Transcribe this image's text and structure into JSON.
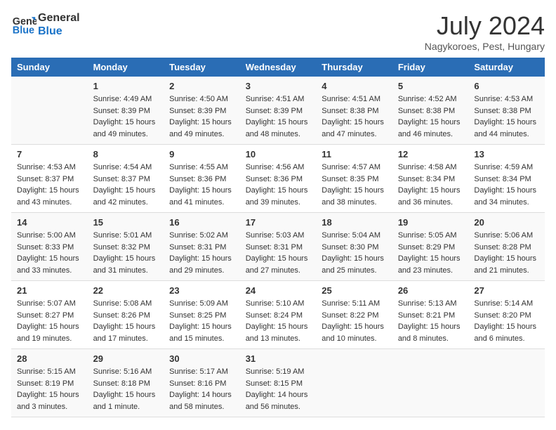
{
  "header": {
    "logo_line1": "General",
    "logo_line2": "Blue",
    "month_title": "July 2024",
    "location": "Nagykoroes, Pest, Hungary"
  },
  "columns": [
    "Sunday",
    "Monday",
    "Tuesday",
    "Wednesday",
    "Thursday",
    "Friday",
    "Saturday"
  ],
  "weeks": [
    [
      {
        "day": "",
        "info": ""
      },
      {
        "day": "1",
        "info": "Sunrise: 4:49 AM\nSunset: 8:39 PM\nDaylight: 15 hours\nand 49 minutes."
      },
      {
        "day": "2",
        "info": "Sunrise: 4:50 AM\nSunset: 8:39 PM\nDaylight: 15 hours\nand 49 minutes."
      },
      {
        "day": "3",
        "info": "Sunrise: 4:51 AM\nSunset: 8:39 PM\nDaylight: 15 hours\nand 48 minutes."
      },
      {
        "day": "4",
        "info": "Sunrise: 4:51 AM\nSunset: 8:38 PM\nDaylight: 15 hours\nand 47 minutes."
      },
      {
        "day": "5",
        "info": "Sunrise: 4:52 AM\nSunset: 8:38 PM\nDaylight: 15 hours\nand 46 minutes."
      },
      {
        "day": "6",
        "info": "Sunrise: 4:53 AM\nSunset: 8:38 PM\nDaylight: 15 hours\nand 44 minutes."
      }
    ],
    [
      {
        "day": "7",
        "info": "Sunrise: 4:53 AM\nSunset: 8:37 PM\nDaylight: 15 hours\nand 43 minutes."
      },
      {
        "day": "8",
        "info": "Sunrise: 4:54 AM\nSunset: 8:37 PM\nDaylight: 15 hours\nand 42 minutes."
      },
      {
        "day": "9",
        "info": "Sunrise: 4:55 AM\nSunset: 8:36 PM\nDaylight: 15 hours\nand 41 minutes."
      },
      {
        "day": "10",
        "info": "Sunrise: 4:56 AM\nSunset: 8:36 PM\nDaylight: 15 hours\nand 39 minutes."
      },
      {
        "day": "11",
        "info": "Sunrise: 4:57 AM\nSunset: 8:35 PM\nDaylight: 15 hours\nand 38 minutes."
      },
      {
        "day": "12",
        "info": "Sunrise: 4:58 AM\nSunset: 8:34 PM\nDaylight: 15 hours\nand 36 minutes."
      },
      {
        "day": "13",
        "info": "Sunrise: 4:59 AM\nSunset: 8:34 PM\nDaylight: 15 hours\nand 34 minutes."
      }
    ],
    [
      {
        "day": "14",
        "info": "Sunrise: 5:00 AM\nSunset: 8:33 PM\nDaylight: 15 hours\nand 33 minutes."
      },
      {
        "day": "15",
        "info": "Sunrise: 5:01 AM\nSunset: 8:32 PM\nDaylight: 15 hours\nand 31 minutes."
      },
      {
        "day": "16",
        "info": "Sunrise: 5:02 AM\nSunset: 8:31 PM\nDaylight: 15 hours\nand 29 minutes."
      },
      {
        "day": "17",
        "info": "Sunrise: 5:03 AM\nSunset: 8:31 PM\nDaylight: 15 hours\nand 27 minutes."
      },
      {
        "day": "18",
        "info": "Sunrise: 5:04 AM\nSunset: 8:30 PM\nDaylight: 15 hours\nand 25 minutes."
      },
      {
        "day": "19",
        "info": "Sunrise: 5:05 AM\nSunset: 8:29 PM\nDaylight: 15 hours\nand 23 minutes."
      },
      {
        "day": "20",
        "info": "Sunrise: 5:06 AM\nSunset: 8:28 PM\nDaylight: 15 hours\nand 21 minutes."
      }
    ],
    [
      {
        "day": "21",
        "info": "Sunrise: 5:07 AM\nSunset: 8:27 PM\nDaylight: 15 hours\nand 19 minutes."
      },
      {
        "day": "22",
        "info": "Sunrise: 5:08 AM\nSunset: 8:26 PM\nDaylight: 15 hours\nand 17 minutes."
      },
      {
        "day": "23",
        "info": "Sunrise: 5:09 AM\nSunset: 8:25 PM\nDaylight: 15 hours\nand 15 minutes."
      },
      {
        "day": "24",
        "info": "Sunrise: 5:10 AM\nSunset: 8:24 PM\nDaylight: 15 hours\nand 13 minutes."
      },
      {
        "day": "25",
        "info": "Sunrise: 5:11 AM\nSunset: 8:22 PM\nDaylight: 15 hours\nand 10 minutes."
      },
      {
        "day": "26",
        "info": "Sunrise: 5:13 AM\nSunset: 8:21 PM\nDaylight: 15 hours\nand 8 minutes."
      },
      {
        "day": "27",
        "info": "Sunrise: 5:14 AM\nSunset: 8:20 PM\nDaylight: 15 hours\nand 6 minutes."
      }
    ],
    [
      {
        "day": "28",
        "info": "Sunrise: 5:15 AM\nSunset: 8:19 PM\nDaylight: 15 hours\nand 3 minutes."
      },
      {
        "day": "29",
        "info": "Sunrise: 5:16 AM\nSunset: 8:18 PM\nDaylight: 15 hours\nand 1 minute."
      },
      {
        "day": "30",
        "info": "Sunrise: 5:17 AM\nSunset: 8:16 PM\nDaylight: 14 hours\nand 58 minutes."
      },
      {
        "day": "31",
        "info": "Sunrise: 5:19 AM\nSunset: 8:15 PM\nDaylight: 14 hours\nand 56 minutes."
      },
      {
        "day": "",
        "info": ""
      },
      {
        "day": "",
        "info": ""
      },
      {
        "day": "",
        "info": ""
      }
    ]
  ]
}
